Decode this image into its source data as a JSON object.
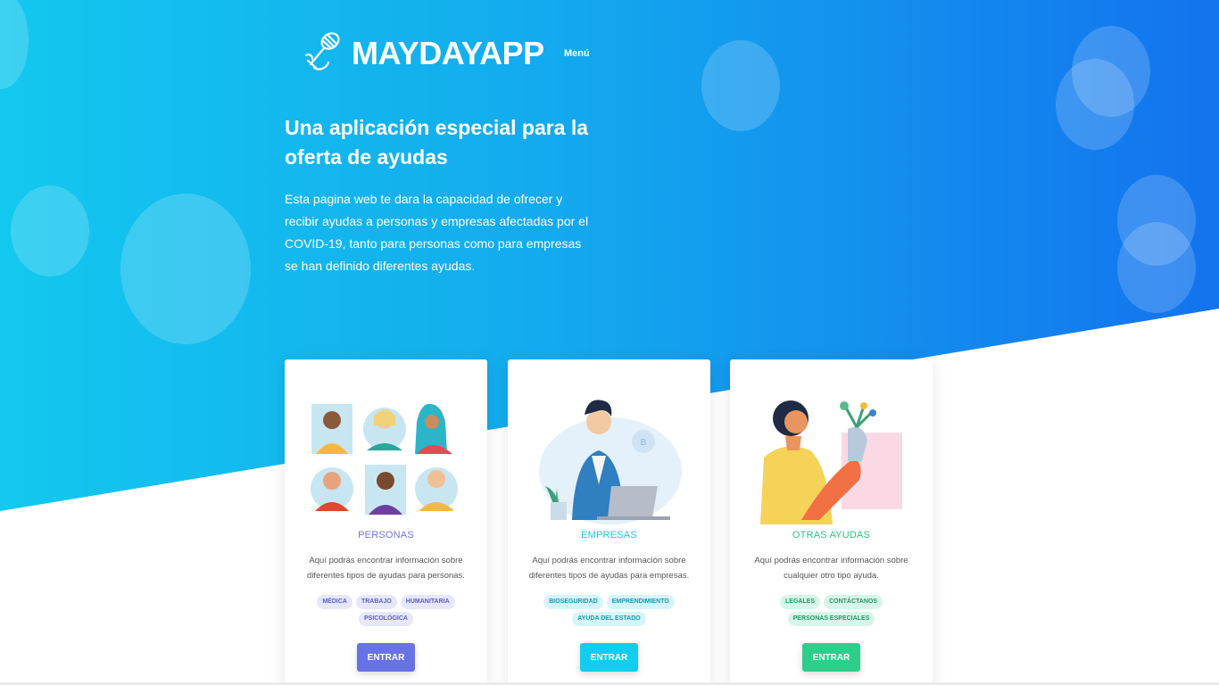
{
  "header": {
    "logo_text": "MAYDAYAPP",
    "menu_label": "Menú"
  },
  "hero": {
    "title": "Una aplicación especial para la oferta de ayudas",
    "description": "Esta pagina web te dara la capacidad de ofrecer y recibir ayudas a personas y empresas afectadas por el COVID-19, tanto para personas como para empresas se han definido diferentes ayudas."
  },
  "cards": [
    {
      "title": "PERSONAS",
      "text": "Aquí podrás encontrar información sobre diferentes tipos de ayudas para personas.",
      "tags": [
        "MÉDICA",
        "TRABAJO",
        "HUMANITARIA",
        "PSICOLÓGICA"
      ],
      "button": "ENTRAR"
    },
    {
      "title": "EMPRESAS",
      "text": "Aquí podrás encontrar información sobre diferentes tipos de ayudas para empresas.",
      "tags": [
        "BIOSEGURIDAD",
        "EMPRENDIMIENTO",
        "AYUDA DEL ESTADO"
      ],
      "button": "ENTRAR"
    },
    {
      "title": "OTRAS AYUDAS",
      "text": "Aquí podrás encontrar información sobre cualquier otro tipo ayuda.",
      "tags": [
        "LEGALES",
        "CONTÁCTANOS",
        "PERSONAS ESPECIALES"
      ],
      "button": "ENTRAR"
    }
  ],
  "colors": {
    "gradient_start": "#13c8ee",
    "gradient_end": "#1373ee",
    "primary": "#6772e5",
    "info": "#11cdef",
    "success": "#2dce89"
  },
  "icons": {
    "logo": "microphone-hand-logo-icon",
    "card1": "people-avatars-illustration",
    "card2": "person-laptop-illustration",
    "card3": "woman-flowers-illustration"
  }
}
